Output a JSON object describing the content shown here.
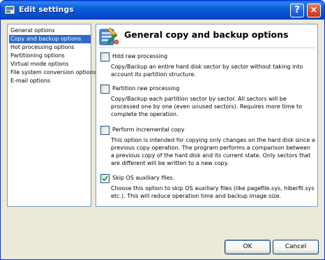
{
  "window": {
    "title": "Edit settings"
  },
  "titlebar": {
    "help_label": "?",
    "close_label": "×"
  },
  "nav": {
    "items": [
      {
        "label": "General options",
        "selected": false
      },
      {
        "label": "Copy and backup options",
        "selected": true
      },
      {
        "label": "Hot processing options",
        "selected": false
      },
      {
        "label": "Partitioning options",
        "selected": false
      },
      {
        "label": "Virtual mode options",
        "selected": false
      },
      {
        "label": "File system conversion options",
        "selected": false
      },
      {
        "label": "E-mail options",
        "selected": false
      }
    ]
  },
  "content": {
    "title": "General copy and backup options",
    "options": [
      {
        "label": "Hdd raw processing",
        "checked": false,
        "description": "Copy/Backup an entire hard disk sector by sector without taking into account its partition structure."
      },
      {
        "label": "Partition raw processing",
        "checked": false,
        "description": "Copy/Backup each partition sector by sector. All sectors will be processed one by one (even unused sectors). Requires more time to complete the operation."
      },
      {
        "label": "Perform incremental copy",
        "checked": false,
        "description": "This option is intended for copying only changes on the hard disk since a previous copy operation. The program performs a comparison between a previous copy of the hard disk and its current state. Only sectors that are different will be written to a new copy."
      },
      {
        "label": "Skip OS auxiliary files.",
        "checked": true,
        "description": "Choose this option to skip OS auxiliary files (like pagefile.sys, hiberfil.sys etc.). This will reduce operation time and backup image size."
      }
    ]
  },
  "buttons": {
    "ok": "OK",
    "cancel": "Cancel"
  },
  "colors": {
    "titlebar": "#0548c8",
    "selection": "#316ac5",
    "dialog_bg": "#ece9d8",
    "checkmark": "#21a121"
  }
}
